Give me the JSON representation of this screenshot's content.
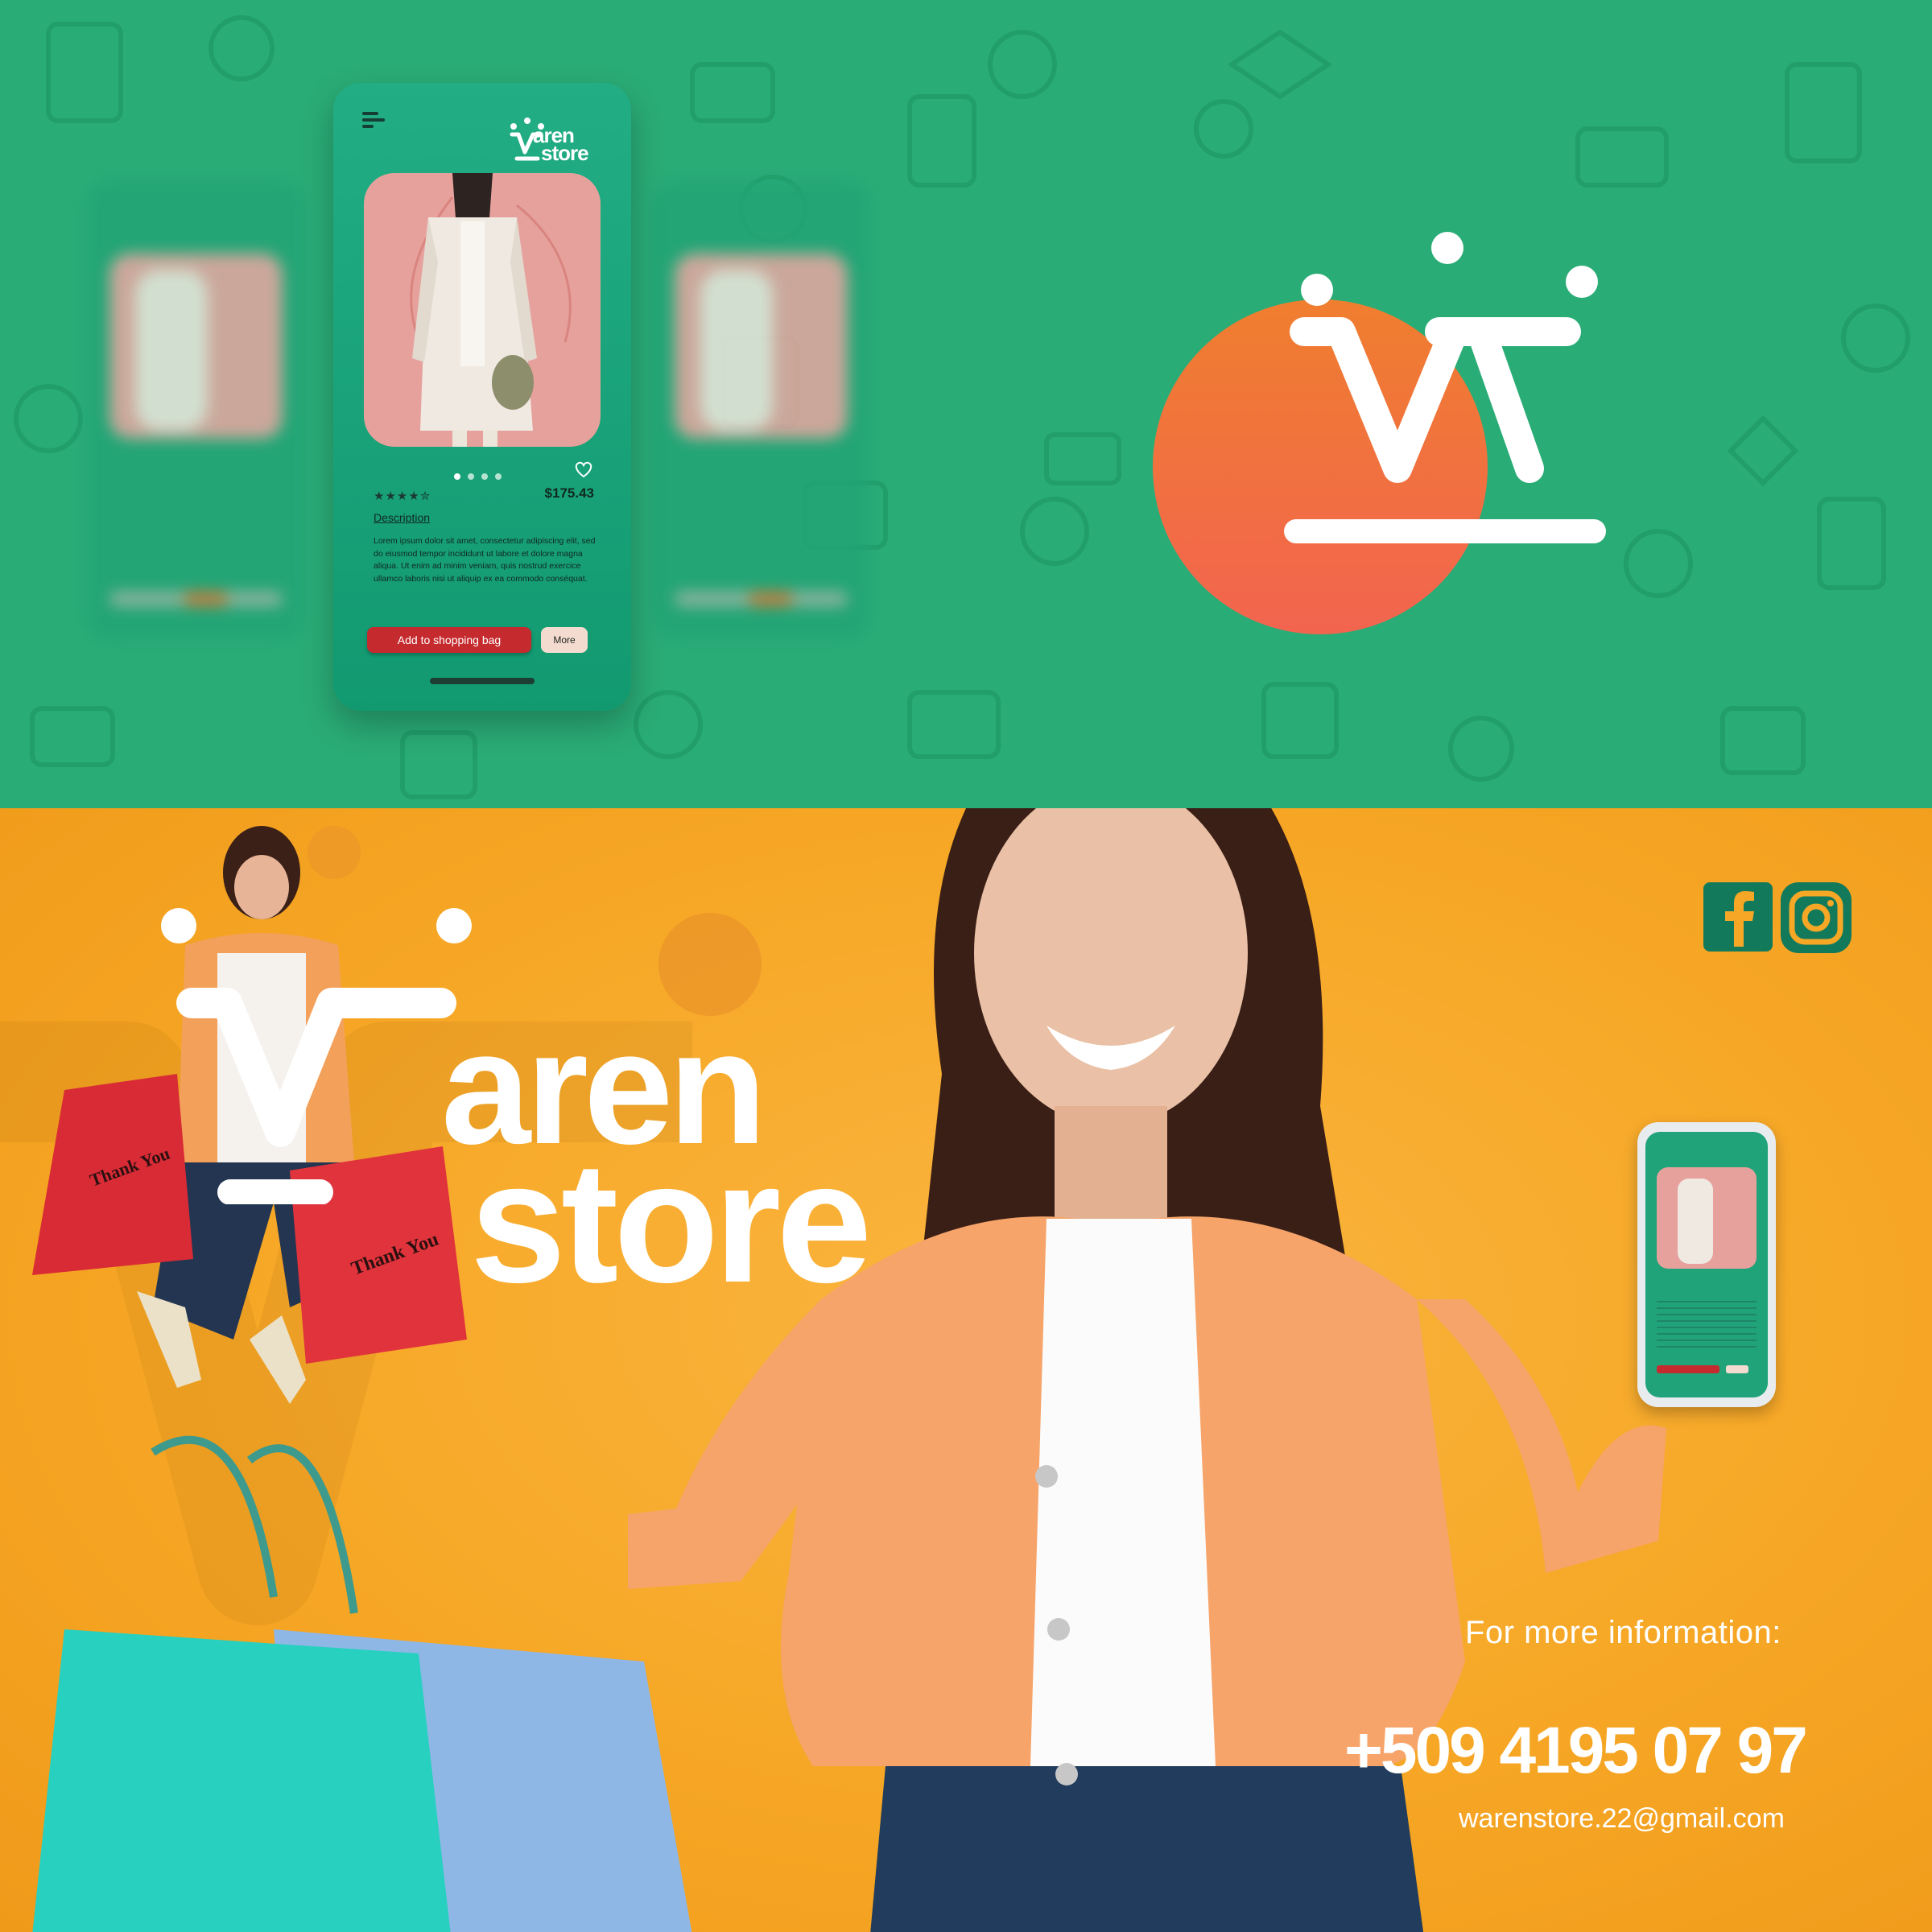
{
  "app": {
    "menu_icon": "hamburger-menu-icon",
    "logo": {
      "line1": "aren",
      "line2": "store"
    },
    "product": {
      "rating_stars": "★★★★✮",
      "rating_value": 4.5,
      "price": "$175.43",
      "description_label": "Description",
      "description": "Lorem ipsum dolor sit amet, consectetur adipiscing elit, sed do eiusmod tempor incididunt ut labore et dolore magna aliqua. Ut enim ad minim veniam, quis nostrud exercice ullamco laboris nisi ut aliquip ex ea commodo conséquat.",
      "carousel": {
        "count": 4,
        "active": 1
      },
      "favorite_icon": "heart-icon"
    },
    "buttons": {
      "add_to_bag": "Add to shopping bag",
      "more": "More"
    }
  },
  "brand": {
    "name_line1": "aren",
    "name_line2": "store",
    "logo_icon": "crown-w-logo-icon"
  },
  "social": {
    "facebook_icon": "facebook-icon",
    "instagram_icon": "instagram-icon"
  },
  "contact": {
    "label": "For more information:",
    "phone": "+509 4195 07 97",
    "email": "warenstore.22@gmail.com"
  },
  "colors": {
    "green": "#2aac76",
    "dark_green": "#127a5b",
    "orange": "#f6a725",
    "accent_orange": "#f26a4b",
    "button_red": "#c52a2e"
  }
}
